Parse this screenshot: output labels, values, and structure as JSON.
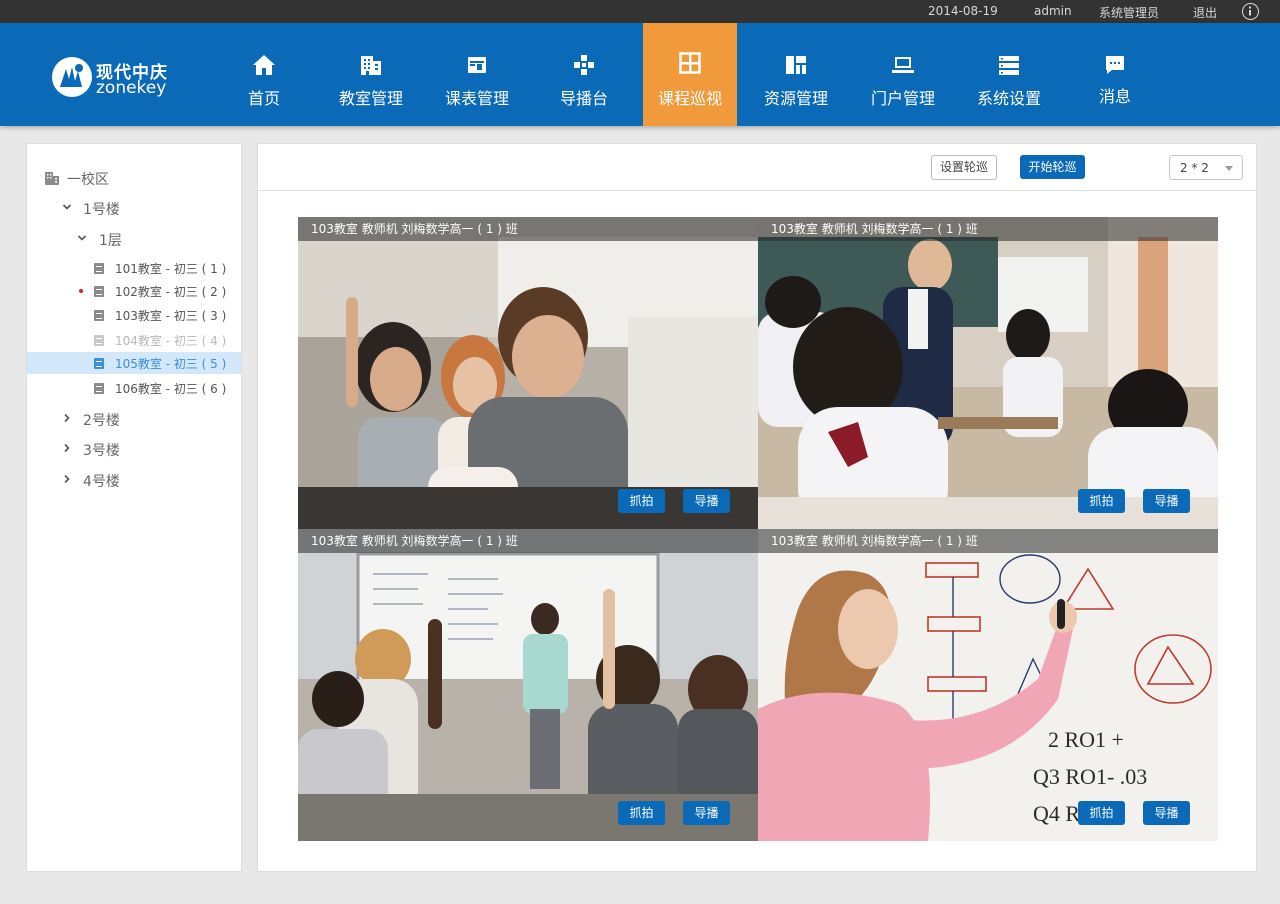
{
  "topbar": {
    "date": "2014-08-19",
    "user": "admin",
    "role": "系统管理员",
    "logout": "退出",
    "info_icon": "info-icon"
  },
  "brand": {
    "name_cn": "现代中庆",
    "name_en": "zonekey"
  },
  "nav": [
    {
      "label": "首页",
      "icon": "home-icon",
      "active": false
    },
    {
      "label": "教室管理",
      "icon": "building-icon",
      "active": false
    },
    {
      "label": "课表管理",
      "icon": "schedule-icon",
      "active": false
    },
    {
      "label": "导播台",
      "icon": "gamepad-icon",
      "active": false
    },
    {
      "label": "课程巡视",
      "icon": "grid-icon",
      "active": true
    },
    {
      "label": "资源管理",
      "icon": "resource-icon",
      "active": false
    },
    {
      "label": "门户管理",
      "icon": "laptop-icon",
      "active": false
    },
    {
      "label": "系统设置",
      "icon": "server-icon",
      "active": false
    },
    {
      "label": "消息",
      "icon": "message-icon",
      "active": false
    }
  ],
  "colors": {
    "header": "#0a6ab7",
    "active_nav": "#f19a3c",
    "topbar": "#333333",
    "selected_row": "#d3e8fa"
  },
  "tree": {
    "campus": "一校区",
    "buildings": [
      {
        "label": "1号楼",
        "expanded": true
      },
      {
        "label": "2号楼",
        "expanded": false
      },
      {
        "label": "3号楼",
        "expanded": false
      },
      {
        "label": "4号楼",
        "expanded": false
      }
    ],
    "floor": "1层",
    "rooms": [
      {
        "label": "101教室 - 初三 ( 1 )",
        "state": "normal"
      },
      {
        "label": "102教室 - 初三 ( 2 )",
        "state": "alert"
      },
      {
        "label": "103教室 - 初三 ( 3 )",
        "state": "normal"
      },
      {
        "label": "104教室 - 初三 ( 4 )",
        "state": "disabled"
      },
      {
        "label": "105教室 - 初三 ( 5 )",
        "state": "selected"
      },
      {
        "label": "106教室 - 初三 ( 6 )",
        "state": "normal"
      }
    ]
  },
  "toolbar": {
    "set_patrol": "设置轮巡",
    "start_patrol": "开始轮巡",
    "layout_value": "2 * 2"
  },
  "videos": [
    {
      "caption": "103教室 教师机 刘梅数学高一 ( 1 ) 班",
      "snapshot": "抓拍",
      "direct": "导播"
    },
    {
      "caption": "103教室 教师机 刘梅数学高一 ( 1 ) 班",
      "snapshot": "抓拍",
      "direct": "导播"
    },
    {
      "caption": "103教室 教师机 刘梅数学高一 ( 1 ) 班",
      "snapshot": "抓拍",
      "direct": "导播"
    },
    {
      "caption": "103教室 教师机 刘梅数学高一 ( 1 ) 班",
      "snapshot": "抓拍",
      "direct": "导播"
    }
  ]
}
